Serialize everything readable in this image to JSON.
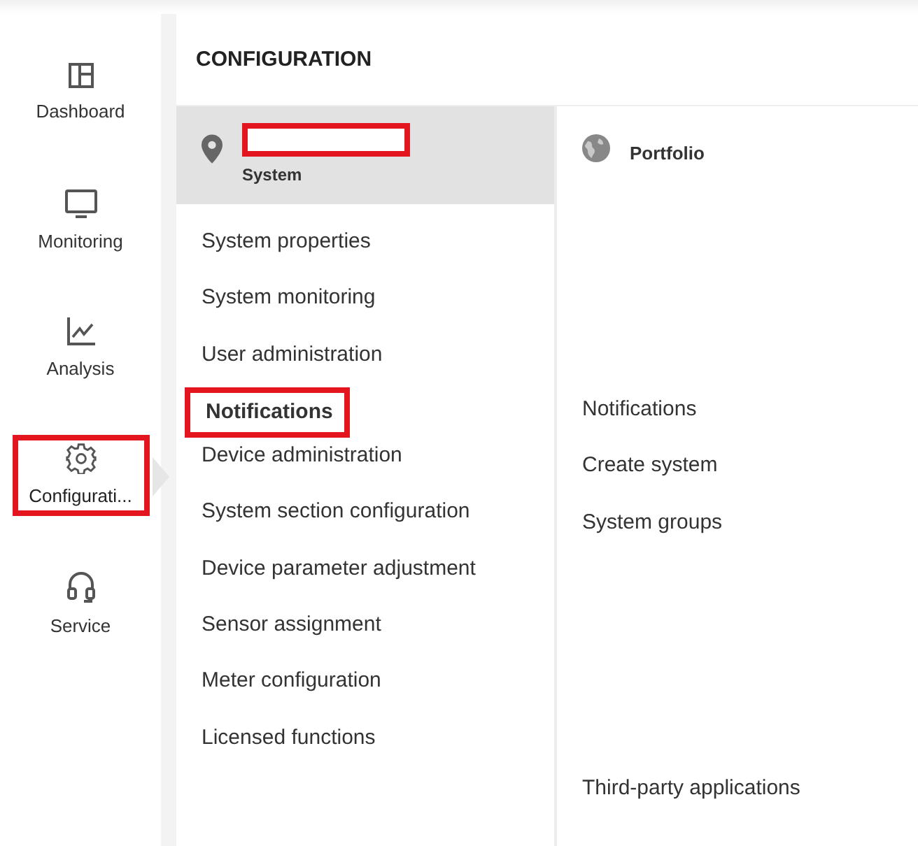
{
  "nav": [
    {
      "label": "Dashboard",
      "selected": false,
      "highlighted": false
    },
    {
      "label": "Monitoring",
      "selected": false,
      "highlighted": false
    },
    {
      "label": "Analysis",
      "selected": false,
      "highlighted": false
    },
    {
      "label": "Configurati...",
      "selected": true,
      "highlighted": true
    },
    {
      "label": "Service",
      "selected": false,
      "highlighted": false
    }
  ],
  "title": "CONFIGURATION",
  "system": {
    "label": "System",
    "redacted": true
  },
  "system_items": [
    {
      "label": "System properties",
      "selected": false,
      "highlighted": false
    },
    {
      "label": "System monitoring",
      "selected": false,
      "highlighted": false
    },
    {
      "label": "User administration",
      "selected": false,
      "highlighted": false
    },
    {
      "label": "Notifications",
      "selected": true,
      "highlighted": true
    },
    {
      "label": "Device administration",
      "selected": false,
      "highlighted": false
    },
    {
      "label": "System section configuration",
      "selected": false,
      "highlighted": false
    },
    {
      "label": "Device parameter adjustment",
      "selected": false,
      "highlighted": false
    },
    {
      "label": "Sensor assignment",
      "selected": false,
      "highlighted": false
    },
    {
      "label": "Meter configuration",
      "selected": false,
      "highlighted": false
    },
    {
      "label": "Licensed functions",
      "selected": false,
      "highlighted": false
    }
  ],
  "portfolio": {
    "label": "Portfolio"
  },
  "portfolio_groups": [
    [
      "Notifications",
      "Create system",
      "System groups"
    ],
    [
      "Third-party applications"
    ]
  ]
}
